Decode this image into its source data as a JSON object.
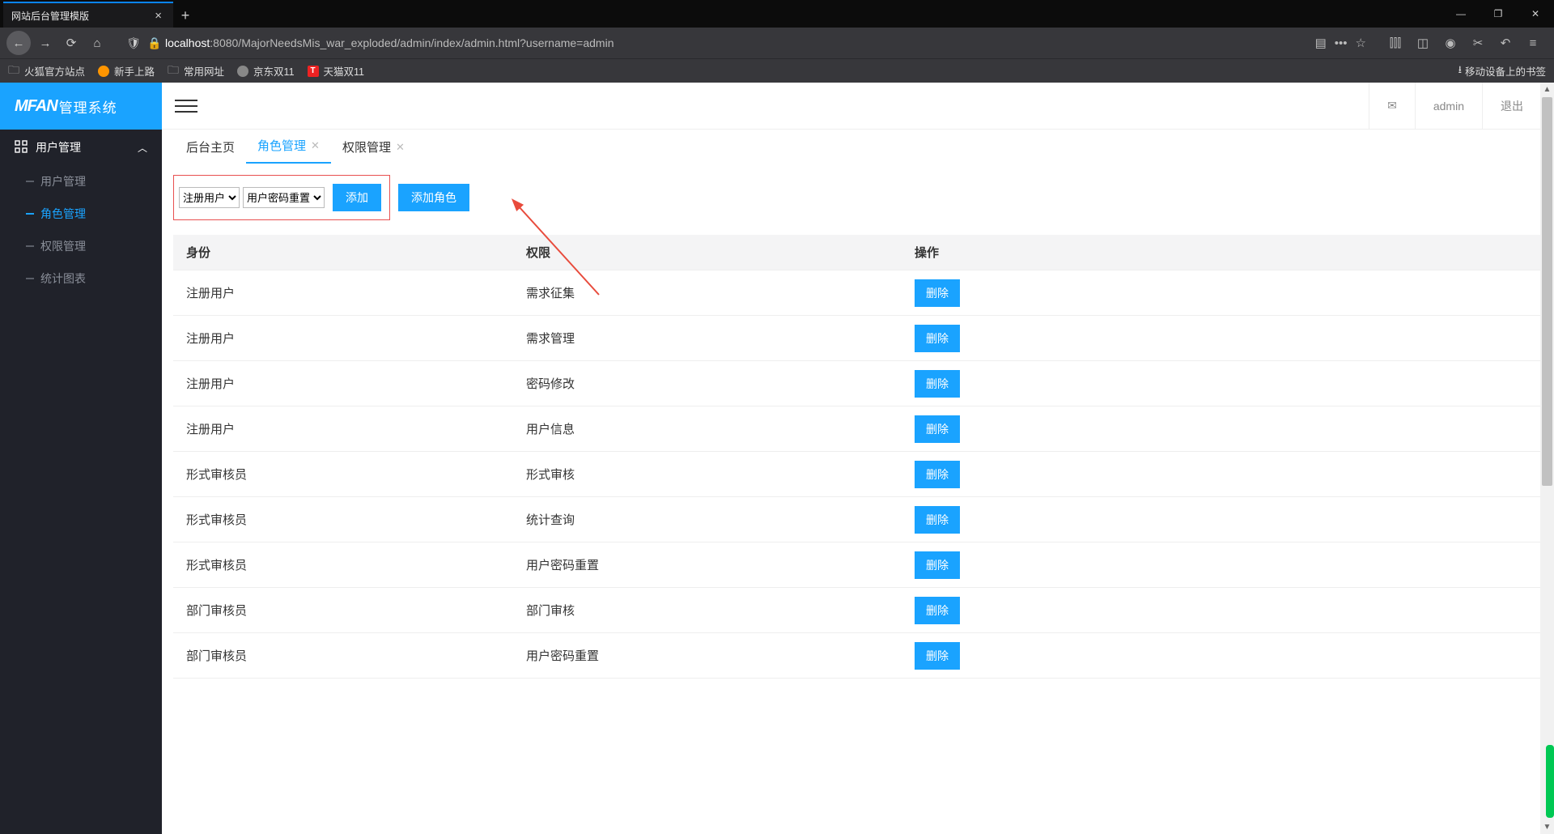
{
  "browser": {
    "tab_title": "网站后台管理模版",
    "url_host": "localhost",
    "url_rest": ":8080/MajorNeedsMis_war_exploded/admin/index/admin.html?username=admin",
    "bookmarks": [
      "火狐官方站点",
      "新手上路",
      "常用网址",
      "京东双11",
      "天猫双11"
    ],
    "mobile_bookmarks": "移动设备上的书签"
  },
  "app": {
    "logo_brand": "MFAN",
    "logo_suffix": "管理系统",
    "top_user": "admin",
    "top_logout": "退出",
    "sidebar": {
      "header": "用户管理",
      "items": [
        "用户管理",
        "角色管理",
        "权限管理",
        "统计图表"
      ],
      "active_index": 1
    },
    "tabs": [
      {
        "label": "后台主页",
        "closable": false,
        "active": false
      },
      {
        "label": "角色管理",
        "closable": true,
        "active": true
      },
      {
        "label": "权限管理",
        "closable": true,
        "active": false
      }
    ],
    "filter": {
      "role_options": [
        "注册用户"
      ],
      "perm_options": [
        "用户密码重置"
      ],
      "add_label": "添加",
      "add_role_label": "添加角色"
    },
    "table": {
      "headers": [
        "身份",
        "权限",
        "操作"
      ],
      "delete_label": "删除",
      "rows": [
        {
          "role": "注册用户",
          "perm": "需求征集"
        },
        {
          "role": "注册用户",
          "perm": "需求管理"
        },
        {
          "role": "注册用户",
          "perm": "密码修改"
        },
        {
          "role": "注册用户",
          "perm": "用户信息"
        },
        {
          "role": "形式审核员",
          "perm": "形式审核"
        },
        {
          "role": "形式审核员",
          "perm": "统计查询"
        },
        {
          "role": "形式审核员",
          "perm": "用户密码重置"
        },
        {
          "role": "部门审核员",
          "perm": "部门审核"
        },
        {
          "role": "部门审核员",
          "perm": "用户密码重置"
        }
      ]
    }
  }
}
